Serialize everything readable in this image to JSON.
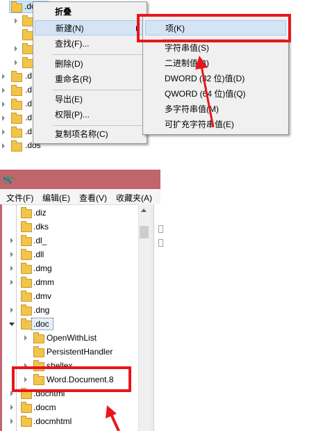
{
  "top_tree": {
    "items": [
      {
        "label": ".doc"
      },
      {
        "label": ""
      },
      {
        "label": ""
      },
      {
        "label": ""
      },
      {
        "label": ""
      },
      {
        "label": ".d"
      },
      {
        "label": ".d"
      },
      {
        "label": ".d"
      },
      {
        "label": ".d"
      },
      {
        "label": ".d"
      },
      {
        "label": ".dos"
      }
    ]
  },
  "context_menu": {
    "items": [
      {
        "label": "折叠"
      },
      {
        "label": "新建(N)"
      },
      {
        "label": "查找(F)..."
      },
      {
        "label": "删除(D)"
      },
      {
        "label": "重命名(R)"
      },
      {
        "label": "导出(E)"
      },
      {
        "label": "权限(P)..."
      },
      {
        "label": "复制项名称(C)"
      }
    ]
  },
  "submenu": {
    "items": [
      {
        "label": "项(K)"
      },
      {
        "label": "字符串值(S)"
      },
      {
        "label": "二进制值(B)"
      },
      {
        "label": "DWORD (32 位)值(D)"
      },
      {
        "label": "QWORD (64 位)值(Q)"
      },
      {
        "label": "多字符串值(M)"
      },
      {
        "label": "可扩充字符串值(E)"
      }
    ]
  },
  "window": {
    "menubar": [
      "文件(F)",
      "编辑(E)",
      "查看(V)",
      "收藏夹(A)"
    ]
  },
  "bottom_tree": {
    "items": [
      {
        "label": ".diz"
      },
      {
        "label": ".dks"
      },
      {
        "label": ".dl_"
      },
      {
        "label": ".dll"
      },
      {
        "label": ".dmg"
      },
      {
        "label": ".dmm"
      },
      {
        "label": ".dmv"
      },
      {
        "label": ".dng"
      },
      {
        "label": ".doc"
      },
      {
        "label": "OpenWithList"
      },
      {
        "label": "PersistentHandler"
      },
      {
        "label": "shellex"
      },
      {
        "label": "Word.Document.8"
      },
      {
        "label": ".dochtml"
      },
      {
        "label": ".docm"
      },
      {
        "label": ".docmhtml"
      }
    ]
  },
  "colors": {
    "highlight_red": "#e8161b",
    "title_bar": "#c0646e",
    "menu_bg": "#f0f0f0",
    "menu_highlight": "#d5e4f5"
  }
}
